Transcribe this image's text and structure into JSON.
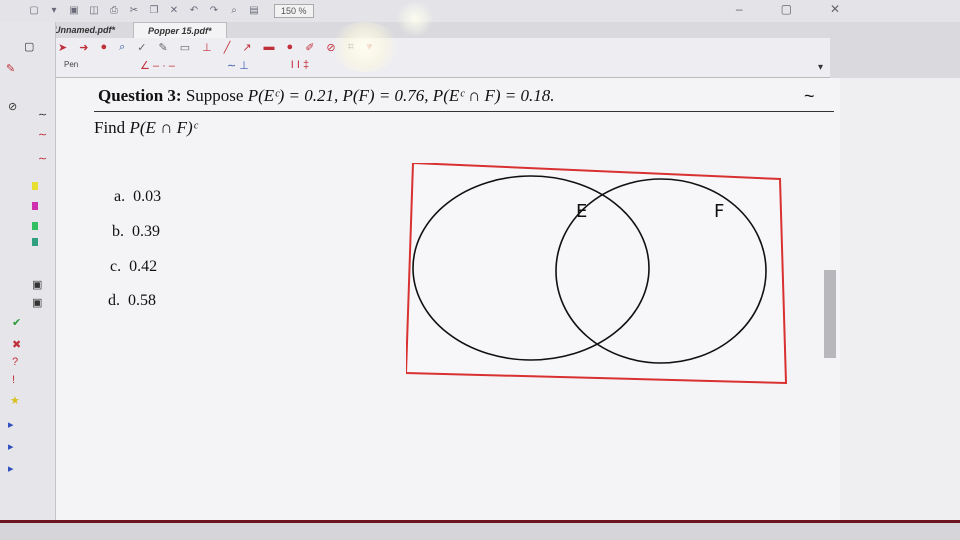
{
  "titlebar": {
    "zoom": "150 %"
  },
  "tabs": [
    {
      "label": "Unnamed.pdf*"
    },
    {
      "label": "Popper 15.pdf*"
    }
  ],
  "toolbar": {
    "pen_label": "Pen"
  },
  "question": {
    "label": "Question 3:",
    "text": "Suppose ",
    "math": "P(Eᶜ) = 0.21, P(F) = 0.76, P(Eᶜ ∩ F) = 0.18.",
    "find_text": "Find ",
    "find_math": "P(E ∩ F)ᶜ",
    "tilde": "~"
  },
  "choices": [
    {
      "letter": "a.",
      "value": "0.03"
    },
    {
      "letter": "b.",
      "value": "0.39"
    },
    {
      "letter": "c.",
      "value": "0.42"
    },
    {
      "letter": "d.",
      "value": "0.58"
    }
  ],
  "venn": {
    "label_e": "E",
    "label_f": "F",
    "border_color": "#d93030"
  },
  "icons": [
    "new-icon",
    "save-icon",
    "print-icon",
    "cut-icon",
    "close-icon",
    "undo-icon",
    "redo-icon",
    "find-icon",
    "minimize-icon",
    "maximize-icon",
    "window-close-icon",
    "pointer-icon",
    "zoom-icon",
    "highlight-icon",
    "pen-icon",
    "shape-icon",
    "check-icon",
    "cross-icon",
    "question-icon",
    "exclamation-icon",
    "star-icon"
  ]
}
